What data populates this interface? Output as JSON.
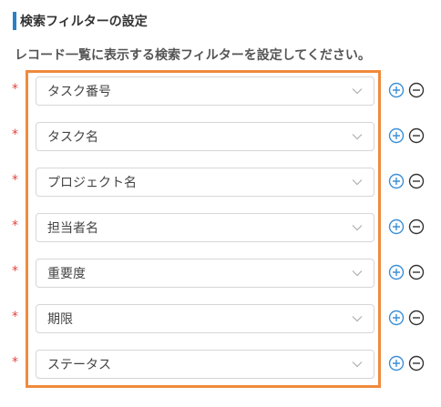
{
  "header": {
    "title": "検索フィルターの設定",
    "accent_color": "#2b7fc4"
  },
  "description": "レコード一覧に表示する検索フィルターを設定してください。",
  "highlight_color": "#f08a3c",
  "required_mark": "*",
  "filters": [
    {
      "label": "タスク番号"
    },
    {
      "label": "タスク名"
    },
    {
      "label": "プロジェクト名"
    },
    {
      "label": "担当者名"
    },
    {
      "label": "重要度"
    },
    {
      "label": "期限"
    },
    {
      "label": "ステータス"
    }
  ],
  "icons": {
    "dropdown": "chevron-down-icon",
    "add": "plus-circle-icon",
    "remove": "minus-circle-icon"
  }
}
